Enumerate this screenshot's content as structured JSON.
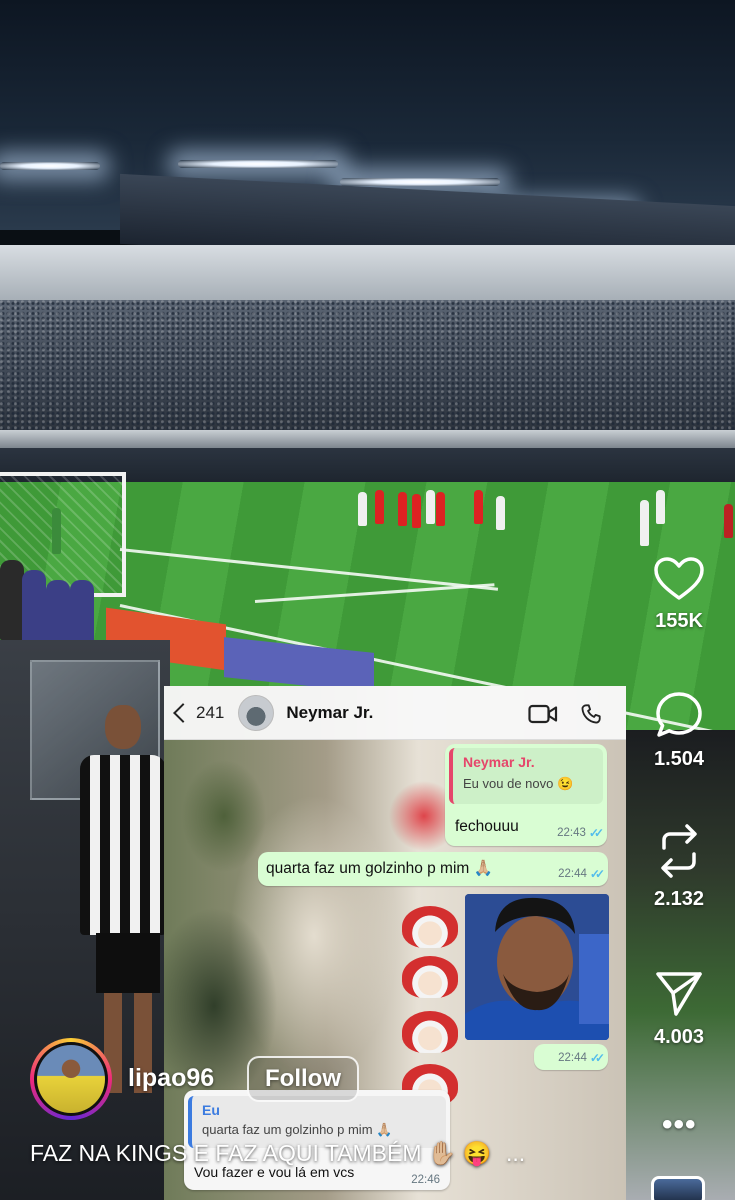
{
  "chat": {
    "back_count": "241",
    "contact_name": "Neymar Jr.",
    "messages": [
      {
        "reply_to_name": "Neymar Jr.",
        "reply_to_text": "Eu vou de novo 😉",
        "text": "fechouuu",
        "time": "22:43"
      },
      {
        "text": "quarta faz um golzinho p mim 🙏🏼",
        "time": "22:44"
      },
      {
        "type": "photo",
        "time": "22:44"
      },
      {
        "reply_to_name": "Eu",
        "reply_to_text": "quarta faz um golzinho p mim 🙏🏼",
        "text": "Vou fazer e vou lá em vcs",
        "time": "22:46"
      }
    ]
  },
  "rail": {
    "likes": "155K",
    "comments": "1.504",
    "reposts": "2.132",
    "shares": "4.003",
    "more": "•••"
  },
  "user": {
    "username": "lipao96",
    "follow_label": "Follow"
  },
  "caption": {
    "text": "FAZ NA KINGS E FAZ AQUI TAMBÉM ✋🏼 😝",
    "more": "..."
  },
  "colors": {
    "bubble_out": "#d9fdd3",
    "quote_accent": "#e5466b",
    "read_ticks": "#53bdeb",
    "ring_gradient": [
      "#f9ce34",
      "#ee2a7b",
      "#6228d7"
    ]
  },
  "icons": [
    "heart-icon",
    "comment-icon",
    "repost-icon",
    "send-icon",
    "video-call-icon",
    "phone-icon",
    "back-chevron-icon"
  ]
}
